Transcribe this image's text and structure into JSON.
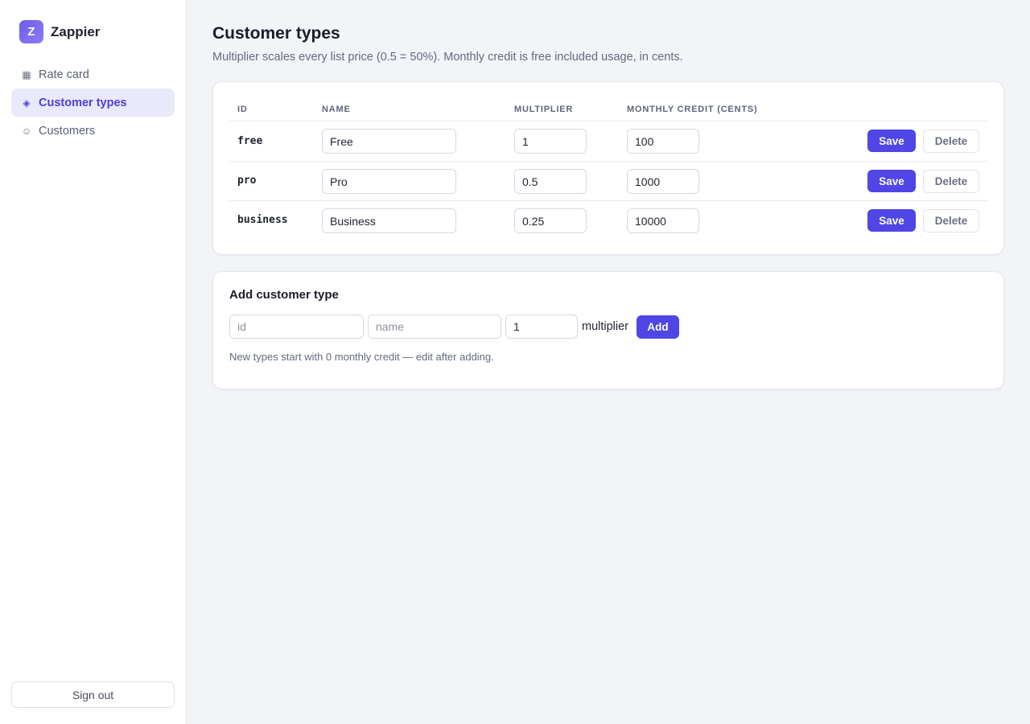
{
  "brand": {
    "logo_letter": "Z",
    "name": "Zappier"
  },
  "nav": [
    {
      "label": "Rate card",
      "icon": "▦",
      "icon_name": "grid-icon",
      "active": false
    },
    {
      "label": "Customer types",
      "icon": "◈",
      "icon_name": "diamond-icon",
      "active": true
    },
    {
      "label": "Customers",
      "icon": "☺",
      "icon_name": "smiley-icon",
      "active": false
    }
  ],
  "signout_label": "Sign out",
  "page": {
    "title": "Customer types",
    "subtitle": "Multiplier scales every list price (0.5 = 50%). Monthly credit is free included usage, in cents."
  },
  "table": {
    "headers": {
      "id": "ID",
      "name": "NAME",
      "multiplier": "MULTIPLIER",
      "credit": "MONTHLY CREDIT (CENTS)"
    },
    "rows": [
      {
        "id": "free",
        "name": "Free",
        "multiplier": "1",
        "credit": "100"
      },
      {
        "id": "pro",
        "name": "Pro",
        "multiplier": "0.5",
        "credit": "1000"
      },
      {
        "id": "business",
        "name": "Business",
        "multiplier": "0.25",
        "credit": "10000"
      }
    ],
    "save_label": "Save",
    "delete_label": "Delete"
  },
  "add": {
    "title": "Add customer type",
    "id_placeholder": "id",
    "name_placeholder": "name",
    "multiplier_value": "1",
    "multiplier_label": "multiplier",
    "add_label": "Add",
    "hint": "New types start with 0 monthly credit — edit after adding."
  },
  "colors": {
    "accent": "#4f46e5",
    "active_nav_bg": "#e9e9fb",
    "page_bg": "#f3f4f8"
  }
}
